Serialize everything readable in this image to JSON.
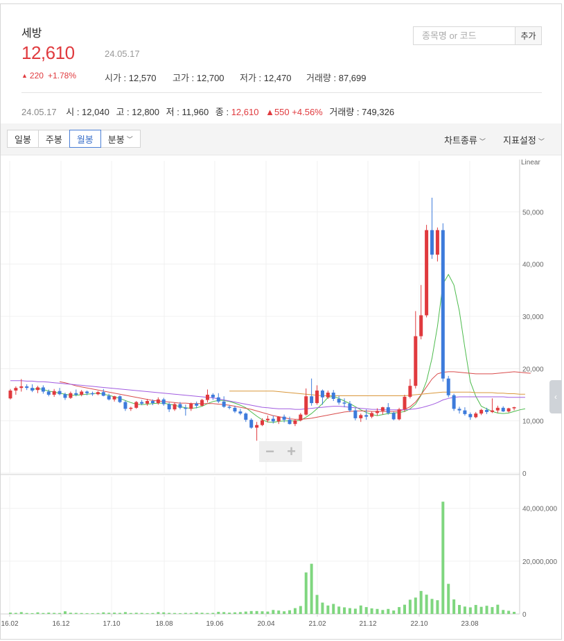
{
  "stock": {
    "name": "세방",
    "price": "12,610",
    "date": "24.05.17",
    "change": "220",
    "change_arrow": "▲",
    "change_pct": "+1.78%",
    "color_up": "#e03a3e",
    "color_down": "#3d7bdb",
    "open_label": "시가",
    "open": "12,570",
    "high_label": "고가",
    "high": "12,700",
    "low_label": "저가",
    "low": "12,470",
    "volume_label": "거래량",
    "volume": "87,699"
  },
  "search": {
    "placeholder": "종목명 or 코드",
    "add_label": "추가"
  },
  "summary": {
    "date": "24.05.17",
    "open_label": "시",
    "open": "12,040",
    "high_label": "고",
    "high": "12,800",
    "low_label": "저",
    "low": "11,960",
    "close_label": "종",
    "close": "12,610",
    "change_arrow": "▲",
    "change": "550",
    "change_pct": "+4.56%",
    "volume_label": "거래량",
    "volume": "749,326"
  },
  "toolbar": {
    "tabs": [
      "일봉",
      "주봉",
      "월봉",
      "분봉"
    ],
    "active_tab": "월봉",
    "chart_type_label": "차트종류",
    "indicator_label": "지표설정"
  },
  "chart_data": {
    "type": "candlestick",
    "interval": "monthly",
    "scale_label": "Linear",
    "x_ticks": [
      "16.02",
      "16.12",
      "17.10",
      "18.08",
      "19.06",
      "20.04",
      "21.02",
      "21.12",
      "22.10",
      "23.08"
    ],
    "price_axis": {
      "ticks": [
        "0",
        "10,000",
        "20,000",
        "30,000",
        "40,000",
        "50,000"
      ],
      "range": [
        0,
        60000
      ]
    },
    "volume_axis": {
      "ticks": [
        "0",
        "20,000,000",
        "40,000,000"
      ],
      "range": [
        0,
        52000000
      ]
    },
    "candles": {
      "fields": [
        "open",
        "high",
        "low",
        "close"
      ],
      "values": [
        [
          14300,
          16100,
          14100,
          15800
        ],
        [
          15800,
          16600,
          15000,
          16300
        ],
        [
          16300,
          18000,
          15600,
          16600
        ],
        [
          16600,
          17000,
          15900,
          16300
        ],
        [
          16300,
          17000,
          15500,
          15800
        ],
        [
          15900,
          16700,
          15300,
          16400
        ],
        [
          16400,
          16800,
          15200,
          15600
        ],
        [
          15600,
          16000,
          14700,
          15000
        ],
        [
          15000,
          16100,
          14600,
          15700
        ],
        [
          15700,
          16300,
          14900,
          15100
        ],
        [
          15100,
          15400,
          14000,
          14400
        ],
        [
          14400,
          15600,
          14200,
          15300
        ],
        [
          15300,
          16000,
          14700,
          15000
        ],
        [
          15000,
          15900,
          14700,
          15600
        ],
        [
          15600,
          15800,
          14900,
          15300
        ],
        [
          15300,
          15600,
          14800,
          15100
        ],
        [
          15100,
          15700,
          14900,
          15500
        ],
        [
          15500,
          16100,
          14700,
          14800
        ],
        [
          14800,
          15200,
          13900,
          14100
        ],
        [
          14100,
          14800,
          13700,
          14700
        ],
        [
          14700,
          14900,
          13400,
          13600
        ],
        [
          13600,
          13900,
          11900,
          12300
        ],
        [
          12300,
          12700,
          11900,
          12500
        ],
        [
          12500,
          13800,
          12300,
          13600
        ],
        [
          13600,
          14000,
          13000,
          13300
        ],
        [
          13300,
          14200,
          12900,
          13800
        ],
        [
          13800,
          14100,
          13000,
          13400
        ],
        [
          13400,
          14500,
          13100,
          14100
        ],
        [
          14100,
          14400,
          12900,
          13200
        ],
        [
          13200,
          13500,
          11700,
          12200
        ],
        [
          12200,
          13500,
          11900,
          13200
        ],
        [
          13200,
          13600,
          12200,
          12500
        ],
        [
          12500,
          13100,
          11000,
          12300
        ],
        [
          12300,
          13500,
          11900,
          13300
        ],
        [
          13300,
          13700,
          12400,
          12900
        ],
        [
          12900,
          14200,
          12800,
          14000
        ],
        [
          14000,
          16000,
          13500,
          15000
        ],
        [
          15000,
          15300,
          14000,
          14500
        ],
        [
          14500,
          15300,
          13400,
          13700
        ],
        [
          13700,
          14700,
          12500,
          12700
        ],
        [
          12700,
          13000,
          12200,
          12500
        ],
        [
          12500,
          12900,
          11500,
          11800
        ],
        [
          11800,
          12300,
          11100,
          11400
        ],
        [
          11400,
          11600,
          9800,
          10200
        ],
        [
          10200,
          10500,
          8500,
          8700
        ],
        [
          8700,
          9800,
          6200,
          9200
        ],
        [
          9200,
          10500,
          9000,
          10100
        ],
        [
          10100,
          11000,
          9700,
          10400
        ],
        [
          10400,
          11000,
          9500,
          9900
        ],
        [
          9900,
          10900,
          9400,
          10800
        ],
        [
          10800,
          11200,
          9700,
          10200
        ],
        [
          10200,
          10800,
          9300,
          9400
        ],
        [
          9400,
          10300,
          9000,
          10100
        ],
        [
          10100,
          11500,
          9900,
          11200
        ],
        [
          11200,
          16200,
          11000,
          14700
        ],
        [
          14700,
          18100,
          12900,
          13400
        ],
        [
          13400,
          16800,
          13100,
          15800
        ],
        [
          15800,
          16000,
          13100,
          14500
        ],
        [
          14500,
          15800,
          14200,
          15400
        ],
        [
          15400,
          15900,
          13800,
          14200
        ],
        [
          14200,
          14800,
          13100,
          13500
        ],
        [
          13500,
          14300,
          12600,
          13300
        ],
        [
          13300,
          13800,
          11700,
          12000
        ],
        [
          12000,
          12500,
          10100,
          10500
        ],
        [
          10500,
          11400,
          9800,
          11100
        ],
        [
          11100,
          12200,
          10200,
          10800
        ],
        [
          10800,
          11800,
          10500,
          11500
        ],
        [
          11500,
          12400,
          11000,
          11900
        ],
        [
          11900,
          12700,
          11200,
          12600
        ],
        [
          12600,
          13400,
          11200,
          11500
        ],
        [
          11500,
          11800,
          10100,
          10300
        ],
        [
          10300,
          12500,
          10100,
          12200
        ],
        [
          12200,
          15000,
          11700,
          14600
        ],
        [
          14600,
          18000,
          14300,
          16700
        ],
        [
          16700,
          31000,
          16200,
          26200
        ],
        [
          26200,
          36000,
          25600,
          30200
        ],
        [
          30200,
          47500,
          29800,
          46500
        ],
        [
          46500,
          52700,
          41000,
          41800
        ],
        [
          41800,
          47000,
          40500,
          46500
        ],
        [
          46500,
          47800,
          17500,
          18100
        ],
        [
          18100,
          18600,
          14500,
          14900
        ],
        [
          14900,
          15200,
          11900,
          12300
        ],
        [
          12300,
          12700,
          11400,
          12000
        ],
        [
          12000,
          12600,
          11000,
          11300
        ],
        [
          11300,
          11600,
          10200,
          10700
        ],
        [
          10700,
          11700,
          10500,
          11400
        ],
        [
          11400,
          12300,
          11100,
          12100
        ],
        [
          12100,
          12500,
          11300,
          11700
        ],
        [
          11700,
          14300,
          11500,
          12000
        ],
        [
          12000,
          12900,
          11500,
          12500
        ],
        [
          12500,
          12800,
          11700,
          11800
        ],
        [
          11800,
          12500,
          11600,
          12400
        ],
        [
          12400,
          12700,
          12000,
          12610
        ]
      ]
    },
    "volume": [
      500000,
      400000,
      700000,
      350000,
      300000,
      600000,
      350000,
      500000,
      400000,
      350000,
      1000000,
      450000,
      400000,
      350000,
      300000,
      300000,
      350000,
      600000,
      450000,
      500000,
      400000,
      700000,
      350000,
      450000,
      400000,
      300000,
      350000,
      700000,
      600000,
      400000,
      350000,
      300000,
      400000,
      350000,
      600000,
      450000,
      350000,
      400000,
      800000,
      700000,
      500000,
      600000,
      700000,
      900000,
      1100000,
      1100000,
      1000000,
      900000,
      1500000,
      1300000,
      1000000,
      1400000,
      2200000,
      3000000,
      15700000,
      19000000,
      7200000,
      4300000,
      3200000,
      3800000,
      2800000,
      2500000,
      2200000,
      2000000,
      3200000,
      2600000,
      2100000,
      1900000,
      1500000,
      1900000,
      1300000,
      2600000,
      3500000,
      5400000,
      6200000,
      8700000,
      7300000,
      5700000,
      5200000,
      42500000,
      11400000,
      5500000,
      3400000,
      2800000,
      2500000,
      3400000,
      2700000,
      3100000,
      2600000,
      3500000,
      1500000,
      1200000,
      800000
    ],
    "moving_averages": [
      {
        "color": "#4cbb4c",
        "values": [
          null,
          null,
          null,
          null,
          16000,
          16200,
          16000,
          15700,
          15500,
          15300,
          15100,
          14900,
          14900,
          15000,
          15100,
          15200,
          15300,
          15100,
          14900,
          14600,
          14300,
          13900,
          13500,
          13200,
          13100,
          13200,
          13300,
          13400,
          13400,
          13200,
          13000,
          12700,
          12500,
          12400,
          12500,
          12800,
          13300,
          13700,
          13900,
          13900,
          13700,
          13400,
          13000,
          12500,
          11700,
          10900,
          10200,
          9800,
          9700,
          9900,
          10000,
          10000,
          10000,
          10100,
          10700,
          11400,
          12300,
          13300,
          14500,
          14700,
          14300,
          13800,
          13300,
          12700,
          12100,
          11600,
          11200,
          11000,
          11200,
          11400,
          11500,
          11600,
          11800,
          12300,
          13200,
          14900,
          17600,
          22000,
          28100,
          36200,
          38000,
          36000,
          31000,
          24000,
          17500,
          14700,
          12800,
          12300,
          11800,
          11500,
          11400,
          11500,
          11800,
          12100,
          12300
        ]
      },
      {
        "color": "#d94b4b",
        "values": [
          null,
          null,
          null,
          null,
          null,
          null,
          null,
          null,
          null,
          17500,
          17300,
          17000,
          16700,
          16500,
          16300,
          16100,
          15900,
          15700,
          15500,
          15300,
          15100,
          14900,
          14700,
          14500,
          14300,
          14100,
          13900,
          13800,
          13700,
          13600,
          13500,
          13400,
          13400,
          13300,
          13300,
          13300,
          13300,
          13300,
          13200,
          13100,
          13000,
          12800,
          12600,
          12400,
          12200,
          11900,
          11600,
          11300,
          11000,
          10800,
          10600,
          10400,
          10300,
          10300,
          10400,
          10500,
          10700,
          10900,
          11100,
          11300,
          11500,
          11700,
          11800,
          11900,
          11900,
          11900,
          11800,
          11800,
          11800,
          11800,
          11800,
          11900,
          12200,
          12700,
          13600,
          15000,
          16500,
          18000,
          19000,
          19300,
          19400,
          19400,
          19300,
          19200,
          19100,
          19000,
          19000,
          19000,
          19000,
          19100,
          19200,
          19300,
          19400,
          19300,
          19200,
          19100
        ]
      },
      {
        "color": "#a15be0",
        "values": [
          17700,
          17700,
          17700,
          17600,
          17600,
          17500,
          17500,
          17400,
          17300,
          17200,
          17100,
          17000,
          16900,
          16800,
          16700,
          16600,
          16500,
          16400,
          16300,
          16200,
          16100,
          16000,
          15900,
          15800,
          15700,
          15600,
          15500,
          15400,
          15300,
          15200,
          15100,
          15000,
          14900,
          14800,
          14700,
          14600,
          14500,
          14400,
          14200,
          14000,
          13800,
          13600,
          13400,
          13200,
          13000,
          12800,
          12600,
          12500,
          12400,
          12300,
          12300,
          12300,
          12200,
          12200,
          12300,
          12400,
          12500,
          12600,
          12700,
          12800,
          12800,
          12700,
          12600,
          12500,
          12400,
          12300,
          12200,
          12200,
          12100,
          12100,
          12100,
          12100,
          12100,
          12200,
          12300,
          12500,
          12800,
          13100,
          13500,
          14000,
          14300,
          14500,
          14600,
          14600,
          14600,
          14600,
          14600,
          14600,
          14600,
          14600,
          14600,
          14500,
          14500,
          14500,
          14500
        ]
      },
      {
        "color": "#d9973a",
        "values": [
          null,
          null,
          null,
          null,
          null,
          null,
          null,
          null,
          null,
          null,
          null,
          null,
          null,
          null,
          null,
          null,
          null,
          null,
          null,
          null,
          null,
          null,
          null,
          null,
          null,
          null,
          null,
          null,
          null,
          null,
          null,
          null,
          null,
          null,
          null,
          null,
          null,
          null,
          null,
          null,
          15700,
          15700,
          15700,
          15700,
          15700,
          15700,
          15700,
          15700,
          15700,
          15600,
          15500,
          15400,
          15300,
          15200,
          15100,
          15000,
          14900,
          14800,
          14800,
          14800,
          14800,
          14800,
          14800,
          14800,
          14800,
          14800,
          14800,
          14800,
          14800,
          14800,
          14800,
          14800,
          14800,
          14900,
          15000,
          15100,
          15200,
          15300,
          15400,
          15500,
          15500,
          15500,
          15500,
          15500,
          15500,
          15400,
          15400,
          15400,
          15400,
          15300,
          15300,
          15200,
          15200,
          15100,
          15100
        ]
      }
    ]
  }
}
